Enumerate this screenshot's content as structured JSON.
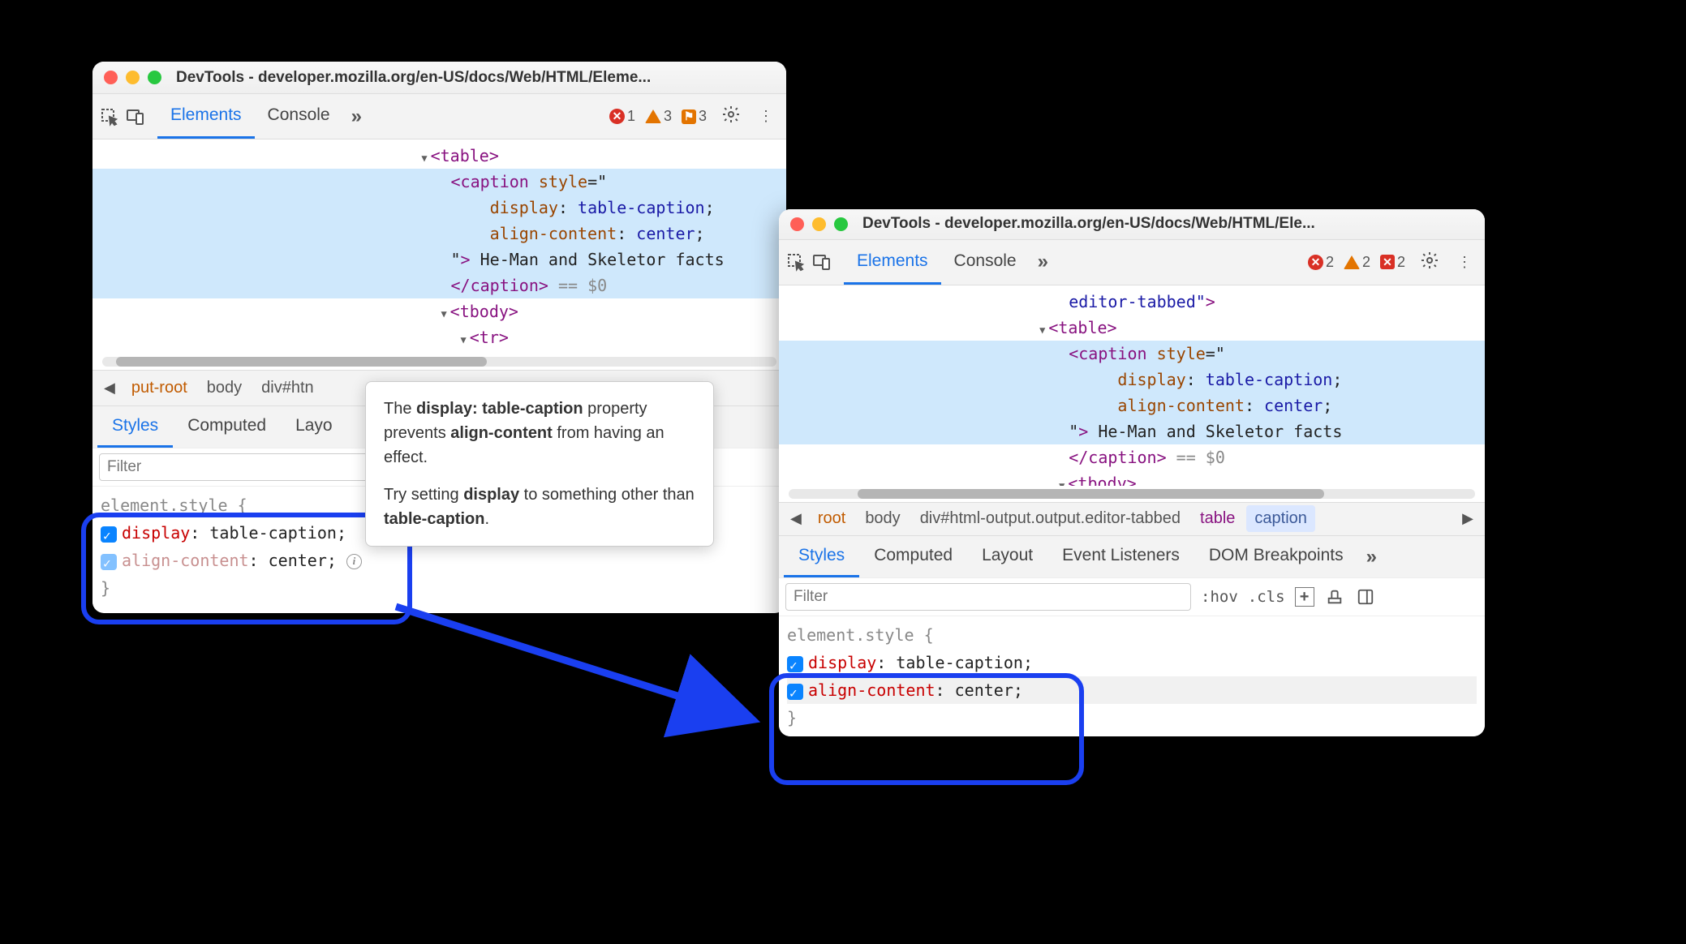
{
  "win1": {
    "title": "DevTools - developer.mozilla.org/en-US/docs/Web/HTML/Eleme...",
    "tabs": [
      "Elements",
      "Console"
    ],
    "badges": {
      "errors": "1",
      "warnings": "3",
      "flags": "3"
    },
    "code": {
      "table": "<table>",
      "caption_open": "<caption ",
      "style_attr": "style",
      "eq": "=\"",
      "css1_p": "display",
      "css1_v": "table-caption",
      "css2_p": "align-content",
      "css2_v": "center",
      "close": "\"",
      "gt": ">",
      "text": " He-Man and Skeletor facts",
      "caption_close": "</caption>",
      "eqzero": " == $0",
      "tbody": "<tbody>",
      "tr": "<tr>"
    },
    "bc": [
      "put-root",
      "body",
      "div#htn"
    ],
    "subtabs": [
      "Styles",
      "Computed",
      "Layo"
    ],
    "filter": "Filter",
    "rules": {
      "sel": "element.style {",
      "p1": "display",
      "v1": "table-caption",
      "p2": "align-content",
      "v2": "center",
      "close": "}"
    }
  },
  "win2": {
    "title": "DevTools - developer.mozilla.org/en-US/docs/Web/HTML/Ele...",
    "tabs": [
      "Elements",
      "Console"
    ],
    "badges": {
      "errors": "2",
      "warnings": "2",
      "flags": "2"
    },
    "code": {
      "edtab": "editor-tabbed\"",
      "gt0": ">",
      "table": "<table>",
      "caption_open": "<caption ",
      "style_attr": "style",
      "eq": "=\"",
      "css1_p": "display",
      "css1_v": "table-caption",
      "css2_p": "align-content",
      "css2_v": "center",
      "close": "\"",
      "gt": ">",
      "text": " He-Man and Skeletor facts",
      "caption_close": "</caption>",
      "eqzero": " == $0",
      "tbody": "<tbody>"
    },
    "bc": [
      "root",
      "body",
      "div#html-output.output.editor-tabbed",
      "table",
      "caption"
    ],
    "subtabs": [
      "Styles",
      "Computed",
      "Layout",
      "Event Listeners",
      "DOM Breakpoints"
    ],
    "filter": "Filter",
    "hov": ":hov",
    "cls": ".cls",
    "rules": {
      "sel": "element.style {",
      "p1": "display",
      "v1": "table-caption",
      "p2": "align-content",
      "v2": "center",
      "close": "}"
    }
  },
  "tooltip": {
    "l1a": "The ",
    "l1b": "display: table-caption",
    "l1c": " property prevents ",
    "l1d": "align-content",
    "l1e": " from having an effect.",
    "l2a": "Try setting ",
    "l2b": "display",
    "l2c": " to something other than ",
    "l2d": "table-caption",
    "l2e": "."
  }
}
